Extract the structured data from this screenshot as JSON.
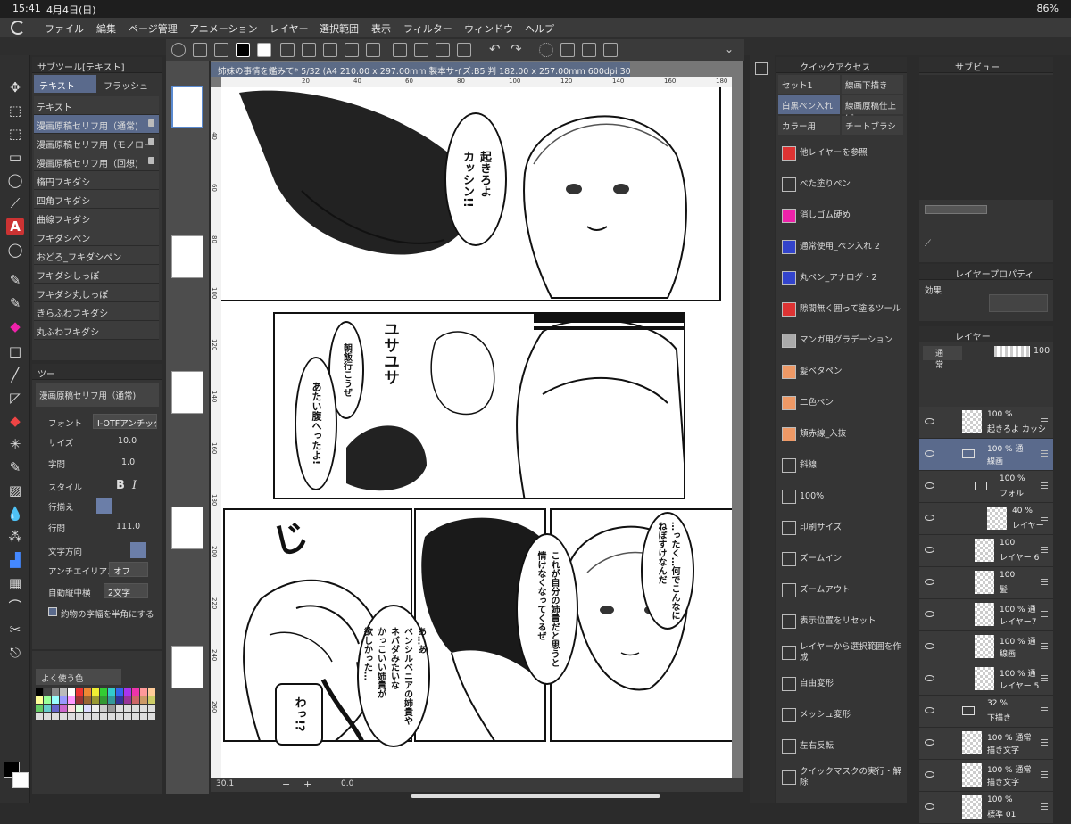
{
  "status": {
    "time": "15:41",
    "date": "4月4日(日)",
    "battery": "86%"
  },
  "menu": [
    "ファイル",
    "編集",
    "ページ管理",
    "アニメーション",
    "レイヤー",
    "選択範囲",
    "表示",
    "フィルター",
    "ウィンドウ",
    "ヘルプ"
  ],
  "subtool": {
    "title": "サブツール[テキスト]",
    "tabs": [
      "テキスト",
      "フラッシュ"
    ],
    "items": [
      {
        "label": "テキスト",
        "lock": false,
        "selected": false
      },
      {
        "label": "漫画原稿セリフ用（通常)",
        "lock": true,
        "selected": true
      },
      {
        "label": "漫画原稿セリフ用（モノロー",
        "lock": true,
        "selected": false
      },
      {
        "label": "漫画原稿セリフ用（回想)",
        "lock": true,
        "selected": false
      },
      {
        "label": "楕円フキダシ",
        "lock": false,
        "selected": false
      },
      {
        "label": "四角フキダシ",
        "lock": false,
        "selected": false
      },
      {
        "label": "曲線フキダシ",
        "lock": false,
        "selected": false
      },
      {
        "label": "フキダシペン",
        "lock": false,
        "selected": false
      },
      {
        "label": "おどろ_フキダシペン",
        "lock": false,
        "selected": false
      },
      {
        "label": "フキダシしっぽ",
        "lock": false,
        "selected": false
      },
      {
        "label": "フキダシ丸しっぽ",
        "lock": false,
        "selected": false
      },
      {
        "label": "きらふわフキダシ",
        "lock": false,
        "selected": false
      },
      {
        "label": "丸ふわフキダシ",
        "lock": false,
        "selected": false
      }
    ]
  },
  "toolprop": {
    "tab": "ツー",
    "name": "漫画原稿セリフ用（通常)",
    "font_label": "フォント",
    "font_value": "I-OTFアンチック",
    "size_label": "サイズ",
    "size_value": "10.0",
    "spacing_label": "字間",
    "spacing_value": "1.0",
    "style_label": "スタイル",
    "style_b": "B",
    "style_i": "I",
    "align_label": "行揃え",
    "linespace_label": "行間",
    "linespace_value": "111.0",
    "direction_label": "文字方向",
    "aa_label": "アンチエイリアス",
    "aa_value": "オフ",
    "tcy_label": "自動縦中横",
    "tcy_value": "2文字",
    "halfwidth_label": "約物の字幅を半角にする"
  },
  "colorset": {
    "title": "よく使う色"
  },
  "document": {
    "tab": "姉妹の事情を鑑みて* 5/32 (A4 210.00 x 297.00mm 製本サイズ:B5 判 182.00 x 257.00mm 600dpi 30.1%)",
    "zoom": "30.1",
    "rotation": "0.0",
    "ruler_h": [
      "20",
      "40",
      "60",
      "80",
      "100",
      "120",
      "140",
      "160",
      "180"
    ],
    "ruler_v": [
      "40",
      "60",
      "80",
      "100",
      "120",
      "140",
      "160",
      "180",
      "200",
      "220",
      "240",
      "260"
    ]
  },
  "manga": {
    "b1": "起きろよ\nカッシン!!",
    "sfx1": "ユサユサ",
    "b2": "朝飯行こうぜ",
    "b3": "あたい腹へったよ!",
    "b4": "…ったく…何でこんなに\nねぼすけなんだ",
    "b5": "これが自分の姉貴だと思うと\n情けなくなってくるぜ",
    "b6": "あ…あ\nペンシルベニアの姉貴や\nネバダみたいな\nかっこいい姉貴が\n欲しかった…",
    "sfx2": "じ",
    "sfx3": "わっ!?"
  },
  "quick": {
    "title": "クイックアクセス",
    "sets": [
      "セット1",
      "線画下描き",
      "白黒ペン入れ",
      "線画原稿仕上げ",
      "カラー用",
      "チートブラシ"
    ],
    "items": [
      {
        "label": "他レイヤーを参照",
        "icon": "red-palette-icon"
      },
      {
        "label": "べた塗りペン",
        "icon": "pen-icon"
      },
      {
        "label": "消しゴム硬め",
        "icon": "eraser-icon"
      },
      {
        "label": "通常使用_ペン入れ 2",
        "icon": "blue-pen-icon"
      },
      {
        "label": "丸ペン_アナログ・2",
        "icon": "blue-pen-icon"
      },
      {
        "label": "隙間無く囲って塗るツール",
        "icon": "fill-icon"
      },
      {
        "label": "マンガ用グラデーション",
        "icon": "gradient-icon"
      },
      {
        "label": "髪ベタペン",
        "icon": "brush-icon"
      },
      {
        "label": "二色ペン",
        "icon": "brush-icon"
      },
      {
        "label": "頬赤線_入抜",
        "icon": "brush-icon"
      },
      {
        "label": "斜線",
        "icon": "hatch-icon"
      },
      {
        "label": "100%",
        "icon": "zoom-icon"
      },
      {
        "label": "印刷サイズ",
        "icon": "print-icon"
      },
      {
        "label": "ズームイン",
        "icon": "zoom-in-icon"
      },
      {
        "label": "ズームアウト",
        "icon": "zoom-out-icon"
      },
      {
        "label": "表示位置をリセット",
        "icon": "move-icon"
      },
      {
        "label": "レイヤーから選択範囲を作成",
        "icon": "selection-icon"
      },
      {
        "label": "自由変形",
        "icon": "transform-icon"
      },
      {
        "label": "メッシュ変形",
        "icon": "mesh-icon"
      },
      {
        "label": "左右反転",
        "icon": "flip-icon"
      },
      {
        "label": "クイックマスクの実行・解除",
        "icon": "mask-icon"
      }
    ]
  },
  "subview": {
    "title": "サブビュー"
  },
  "layerprop": {
    "title": "レイヤープロパティ",
    "effect": "効果"
  },
  "layers": {
    "tabs": [
      "レイヤー"
    ],
    "blend": "通常",
    "opacity": "100",
    "rows": [
      {
        "pct": "100 %",
        "name": "起きろよ カッシ",
        "indent": 0,
        "sel": false,
        "folder": false
      },
      {
        "pct": "100 % 通",
        "name": "線画",
        "indent": 0,
        "sel": true,
        "folder": true
      },
      {
        "pct": "100 %",
        "name": "フォル",
        "indent": 1,
        "sel": false,
        "folder": true
      },
      {
        "pct": "40 %",
        "name": "レイヤー",
        "indent": 2,
        "sel": false,
        "folder": false
      },
      {
        "pct": "100",
        "name": "レイヤー 6",
        "indent": 1,
        "sel": false,
        "folder": false
      },
      {
        "pct": "100",
        "name": "髪",
        "indent": 1,
        "sel": false,
        "folder": false
      },
      {
        "pct": "100 % 通",
        "name": "レイヤー7",
        "indent": 1,
        "sel": false,
        "folder": false
      },
      {
        "pct": "100 % 通",
        "name": "線画",
        "indent": 1,
        "sel": false,
        "folder": false
      },
      {
        "pct": "100 % 通",
        "name": "レイヤー 5",
        "indent": 1,
        "sel": false,
        "folder": false
      },
      {
        "pct": "32 %",
        "name": "下描き",
        "indent": 0,
        "sel": false,
        "folder": true
      },
      {
        "pct": "100 % 通常",
        "name": "描き文字",
        "indent": 0,
        "sel": false,
        "folder": false
      },
      {
        "pct": "100 % 通常",
        "name": "描き文字",
        "indent": 0,
        "sel": false,
        "folder": false
      },
      {
        "pct": "100 %",
        "name": "標準 01",
        "indent": 0,
        "sel": false,
        "folder": false
      }
    ]
  }
}
